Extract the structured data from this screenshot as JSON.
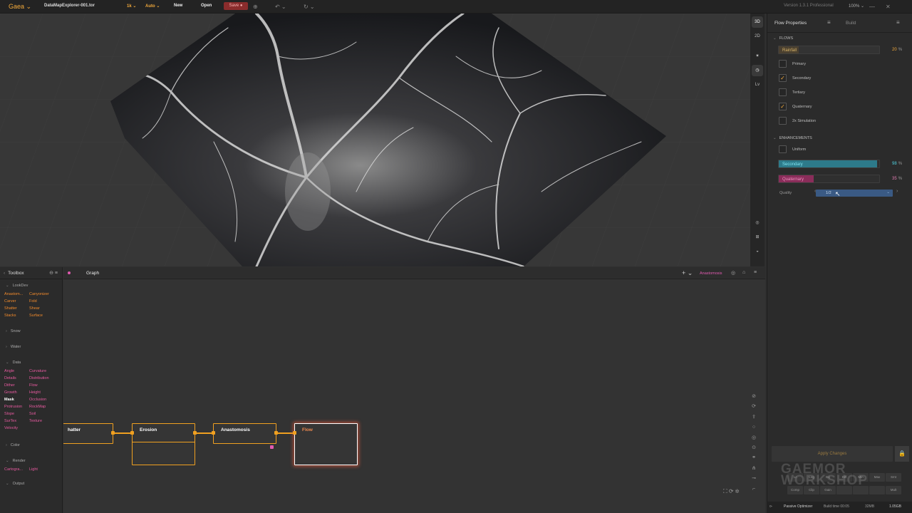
{
  "app": {
    "logo": "Gaea ⌄",
    "document": "DataMapExplorer-001.tor",
    "resolution": "1k ⌄",
    "mode": "Auto ⌄",
    "new_label": "New",
    "open_label": "Open",
    "save_label": "Save ●",
    "version": "Version 1.3.1 Professional",
    "zoom": "100% ⌄"
  },
  "viewport_tools": [
    "3D",
    "2D",
    "✷",
    "◷",
    "Lv",
    "◎",
    "⊞",
    "◒"
  ],
  "toolbox": {
    "title": "Toolbox",
    "categories": [
      {
        "name": "LookDev",
        "nodes": [
          "Anastom...",
          "Canyonizer",
          "Carver",
          "Fold",
          "Shatter",
          "Shear",
          "Stacks",
          "Surface"
        ]
      },
      {
        "name": "Snow"
      },
      {
        "name": "Water"
      },
      {
        "name": "Data",
        "nodes": [
          "Angle",
          "Curvature",
          "Details",
          "Distribution",
          "Dither",
          "Flow",
          "Growth",
          "Height",
          "Mask",
          "Occlusion",
          "Protrusion",
          "RockMap",
          "Slope",
          "Soil",
          "SurTex",
          "Texture",
          "Velocity"
        ]
      },
      {
        "name": "Color"
      },
      {
        "name": "Render",
        "nodes": [
          "Cartogra...",
          "Light"
        ]
      },
      {
        "name": "Output"
      }
    ]
  },
  "graph": {
    "tab": "Graph",
    "active_node": "Anastomosis",
    "nodes": [
      "hatter",
      "Erosion",
      "Anastomosis",
      "Flow"
    ]
  },
  "properties": {
    "tab_flow": "Flow Properties",
    "tab_build": "Build",
    "flows_header": "FLOWS",
    "rainfall": {
      "label": "Rainfall",
      "value": "20",
      "unit": "%",
      "fraction": 0.2
    },
    "checkboxes": [
      {
        "label": "Primary",
        "checked": false
      },
      {
        "label": "Secondary",
        "checked": true
      },
      {
        "label": "Tertiary",
        "checked": false
      },
      {
        "label": "Quaternary",
        "checked": true
      },
      {
        "label": "2x Simulation",
        "checked": false
      }
    ],
    "enhancements_header": "ENHANCEMENTS",
    "uniform": {
      "label": "Uniform",
      "checked": false
    },
    "secondary": {
      "label": "Secondary",
      "value": "98",
      "unit": "%",
      "fraction": 0.98,
      "color": "#2d7a8a"
    },
    "quaternary": {
      "label": "Quaternary",
      "value": "35",
      "unit": "%",
      "fraction": 0.35,
      "color": "#8a2d5a"
    },
    "quality_label": "Quality",
    "quality_value": "1/2",
    "apply_label": "Apply Changes",
    "buttons": [
      "Lr",
      "Log",
      "Eq",
      "Diff",
      "Min",
      "Max",
      "Smt",
      "Comp",
      "Clip",
      "Gain",
      "",
      "",
      "",
      "Mult"
    ]
  },
  "watermark": "GAEMOR\nWORKSHOP",
  "status": {
    "optimizer": "Passive Optimizer",
    "build_time": "Build time 00:05",
    "mem1": "32MB",
    "mem2": "1.05GB"
  }
}
